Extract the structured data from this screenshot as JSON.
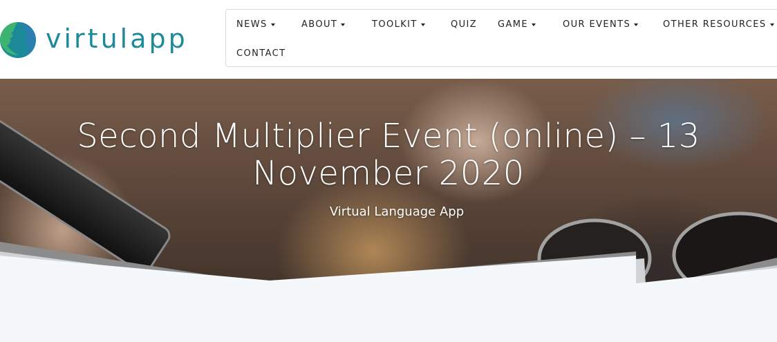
{
  "brand": {
    "name": "virtulapp",
    "color": "#1d8a9a",
    "accent": "#3cb371"
  },
  "nav": {
    "news": "NEWS",
    "about": "ABOUT",
    "toolkit": "TOOLKIT",
    "quiz": "QUIZ",
    "game": "GAME",
    "our_events": "OUR EVENTS",
    "other_resources": "OTHER RESOURCES",
    "contact": "CONTACT"
  },
  "hero": {
    "title": "Second Multiplier Event (online) – 13 November 2020",
    "subtitle": "Virtual Language App"
  }
}
